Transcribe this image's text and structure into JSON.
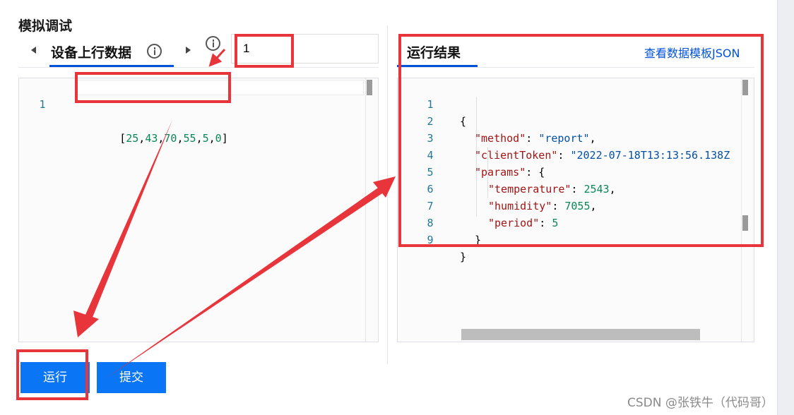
{
  "page": {
    "title": "模拟调试"
  },
  "left_panel": {
    "tab_label": "设备上行数据",
    "count_input_value": "1",
    "editor": {
      "lines": [
        {
          "num": "1",
          "tokens": [
            "[",
            "25",
            ",",
            "43",
            ",",
            "70",
            ",",
            "55",
            ",",
            "5",
            ",",
            "0",
            "]"
          ]
        }
      ]
    }
  },
  "right_panel": {
    "tab_label": "运行结果",
    "view_template_link": "查看数据模板JSON",
    "editor": {
      "line_numbers": [
        "1",
        "2",
        "3",
        "4",
        "5",
        "6",
        "7",
        "8",
        "9"
      ],
      "l1": "{",
      "l2_key": "\"method\"",
      "l2_sep": ": ",
      "l2_val": "\"report\"",
      "l2_end": ",",
      "l3_key": "\"clientToken\"",
      "l3_sep": ": ",
      "l3_val": "\"2022-07-18T13:13:56.138Z",
      "l4_key": "\"params\"",
      "l4_sep": ": {",
      "l5_key": "\"temperature\"",
      "l5_sep": ": ",
      "l5_val": "2543",
      "l5_end": ",",
      "l6_key": "\"humidity\"",
      "l6_sep": ": ",
      "l6_val": "7055",
      "l6_end": ",",
      "l7_key": "\"period\"",
      "l7_sep": ": ",
      "l7_val": "5",
      "l8": "}",
      "l9": "}"
    }
  },
  "buttons": {
    "run_label": "运行",
    "submit_label": "提交"
  },
  "watermark": "CSDN @张铁牛（代码哥）",
  "colors": {
    "primary": "#0a75f5",
    "tab_underline": "#0052d9",
    "annotation": "#e8353b",
    "json_key": "#a31515",
    "json_string": "#0451a5",
    "json_number": "#098658",
    "line_number": "#237893"
  }
}
